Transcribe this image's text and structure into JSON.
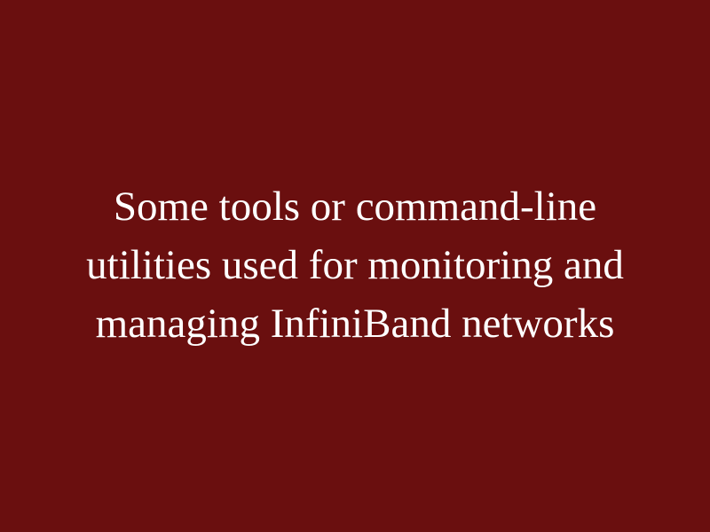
{
  "slide": {
    "text": "Some tools or command-line utilities used for monitoring and managing InfiniBand networks",
    "background_color": "#6a0f0f",
    "text_color": "#ffffff"
  }
}
